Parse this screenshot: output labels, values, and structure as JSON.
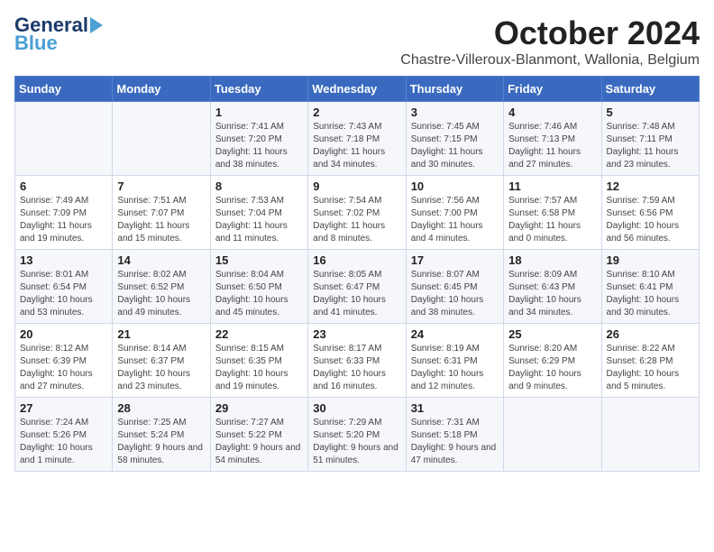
{
  "logo": {
    "text_general": "General",
    "text_blue": "Blue"
  },
  "header": {
    "month": "October 2024",
    "location": "Chastre-Villeroux-Blanmont, Wallonia, Belgium"
  },
  "weekdays": [
    "Sunday",
    "Monday",
    "Tuesday",
    "Wednesday",
    "Thursday",
    "Friday",
    "Saturday"
  ],
  "weeks": [
    [
      {
        "day": "",
        "info": ""
      },
      {
        "day": "",
        "info": ""
      },
      {
        "day": "1",
        "info": "Sunrise: 7:41 AM\nSunset: 7:20 PM\nDaylight: 11 hours and 38 minutes."
      },
      {
        "day": "2",
        "info": "Sunrise: 7:43 AM\nSunset: 7:18 PM\nDaylight: 11 hours and 34 minutes."
      },
      {
        "day": "3",
        "info": "Sunrise: 7:45 AM\nSunset: 7:15 PM\nDaylight: 11 hours and 30 minutes."
      },
      {
        "day": "4",
        "info": "Sunrise: 7:46 AM\nSunset: 7:13 PM\nDaylight: 11 hours and 27 minutes."
      },
      {
        "day": "5",
        "info": "Sunrise: 7:48 AM\nSunset: 7:11 PM\nDaylight: 11 hours and 23 minutes."
      }
    ],
    [
      {
        "day": "6",
        "info": "Sunrise: 7:49 AM\nSunset: 7:09 PM\nDaylight: 11 hours and 19 minutes."
      },
      {
        "day": "7",
        "info": "Sunrise: 7:51 AM\nSunset: 7:07 PM\nDaylight: 11 hours and 15 minutes."
      },
      {
        "day": "8",
        "info": "Sunrise: 7:53 AM\nSunset: 7:04 PM\nDaylight: 11 hours and 11 minutes."
      },
      {
        "day": "9",
        "info": "Sunrise: 7:54 AM\nSunset: 7:02 PM\nDaylight: 11 hours and 8 minutes."
      },
      {
        "day": "10",
        "info": "Sunrise: 7:56 AM\nSunset: 7:00 PM\nDaylight: 11 hours and 4 minutes."
      },
      {
        "day": "11",
        "info": "Sunrise: 7:57 AM\nSunset: 6:58 PM\nDaylight: 11 hours and 0 minutes."
      },
      {
        "day": "12",
        "info": "Sunrise: 7:59 AM\nSunset: 6:56 PM\nDaylight: 10 hours and 56 minutes."
      }
    ],
    [
      {
        "day": "13",
        "info": "Sunrise: 8:01 AM\nSunset: 6:54 PM\nDaylight: 10 hours and 53 minutes."
      },
      {
        "day": "14",
        "info": "Sunrise: 8:02 AM\nSunset: 6:52 PM\nDaylight: 10 hours and 49 minutes."
      },
      {
        "day": "15",
        "info": "Sunrise: 8:04 AM\nSunset: 6:50 PM\nDaylight: 10 hours and 45 minutes."
      },
      {
        "day": "16",
        "info": "Sunrise: 8:05 AM\nSunset: 6:47 PM\nDaylight: 10 hours and 41 minutes."
      },
      {
        "day": "17",
        "info": "Sunrise: 8:07 AM\nSunset: 6:45 PM\nDaylight: 10 hours and 38 minutes."
      },
      {
        "day": "18",
        "info": "Sunrise: 8:09 AM\nSunset: 6:43 PM\nDaylight: 10 hours and 34 minutes."
      },
      {
        "day": "19",
        "info": "Sunrise: 8:10 AM\nSunset: 6:41 PM\nDaylight: 10 hours and 30 minutes."
      }
    ],
    [
      {
        "day": "20",
        "info": "Sunrise: 8:12 AM\nSunset: 6:39 PM\nDaylight: 10 hours and 27 minutes."
      },
      {
        "day": "21",
        "info": "Sunrise: 8:14 AM\nSunset: 6:37 PM\nDaylight: 10 hours and 23 minutes."
      },
      {
        "day": "22",
        "info": "Sunrise: 8:15 AM\nSunset: 6:35 PM\nDaylight: 10 hours and 19 minutes."
      },
      {
        "day": "23",
        "info": "Sunrise: 8:17 AM\nSunset: 6:33 PM\nDaylight: 10 hours and 16 minutes."
      },
      {
        "day": "24",
        "info": "Sunrise: 8:19 AM\nSunset: 6:31 PM\nDaylight: 10 hours and 12 minutes."
      },
      {
        "day": "25",
        "info": "Sunrise: 8:20 AM\nSunset: 6:29 PM\nDaylight: 10 hours and 9 minutes."
      },
      {
        "day": "26",
        "info": "Sunrise: 8:22 AM\nSunset: 6:28 PM\nDaylight: 10 hours and 5 minutes."
      }
    ],
    [
      {
        "day": "27",
        "info": "Sunrise: 7:24 AM\nSunset: 5:26 PM\nDaylight: 10 hours and 1 minute."
      },
      {
        "day": "28",
        "info": "Sunrise: 7:25 AM\nSunset: 5:24 PM\nDaylight: 9 hours and 58 minutes."
      },
      {
        "day": "29",
        "info": "Sunrise: 7:27 AM\nSunset: 5:22 PM\nDaylight: 9 hours and 54 minutes."
      },
      {
        "day": "30",
        "info": "Sunrise: 7:29 AM\nSunset: 5:20 PM\nDaylight: 9 hours and 51 minutes."
      },
      {
        "day": "31",
        "info": "Sunrise: 7:31 AM\nSunset: 5:18 PM\nDaylight: 9 hours and 47 minutes."
      },
      {
        "day": "",
        "info": ""
      },
      {
        "day": "",
        "info": ""
      }
    ]
  ]
}
